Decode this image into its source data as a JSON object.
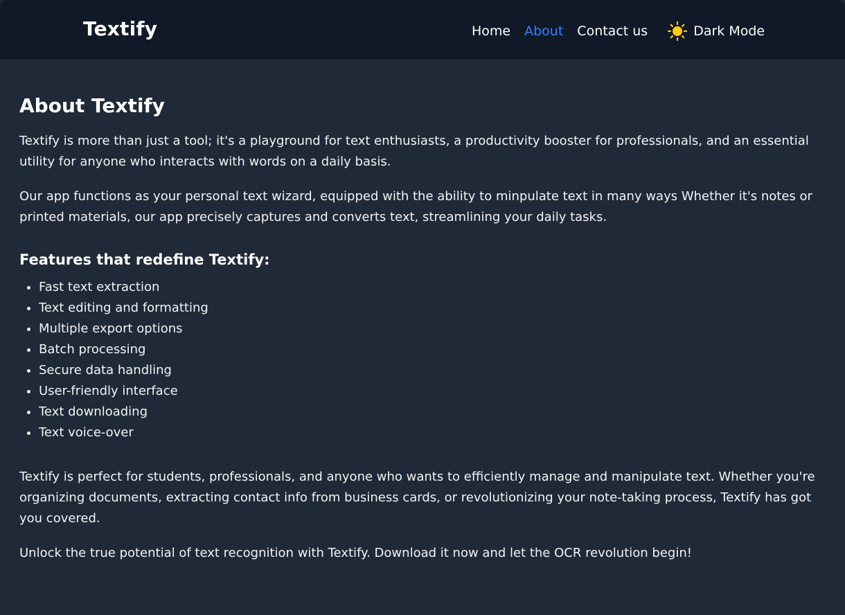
{
  "app": {
    "brand": "Textify"
  },
  "nav": {
    "items": [
      {
        "label": "Home"
      },
      {
        "label": "About"
      },
      {
        "label": "Contact us"
      }
    ],
    "active": "About",
    "mode_toggle_label": "Dark Mode",
    "mode_toggle_icon": "sun-icon"
  },
  "content": {
    "title": "About Textify",
    "intro_paragraphs": [
      "Textify is more than just a tool; it's a playground for text enthusiasts, a productivity booster for professionals, and an essential utility for anyone who interacts with words on a daily basis.",
      "Our app functions as your personal text wizard, equipped with the ability to minpulate text in many ways Whether it's notes or printed materials, our app precisely captures and converts text, streamlining your daily tasks."
    ],
    "features_heading": "Features that redefine Textify:",
    "features": [
      "Fast text extraction",
      "Text editing and formatting",
      "Multiple export options",
      "Batch processing",
      "Secure data handling",
      "User-friendly interface",
      "Text downloading",
      "Text voice-over"
    ],
    "closing_paragraphs": [
      "Textify is perfect for students, professionals, and anyone who wants to efficiently manage and manipulate text. Whether you're organizing documents, extracting contact info from business cards, or revolutionizing your note-taking process, Textify has got you covered.",
      "Unlock the true potential of text recognition with Textify. Download it now and let the OCR revolution begin!"
    ]
  },
  "colors": {
    "page_background": "#1f2937",
    "navbar_background": "#111827",
    "active_link": "#3b82f6",
    "sun_icon": "#facc15",
    "text": "#f3f4f6"
  }
}
